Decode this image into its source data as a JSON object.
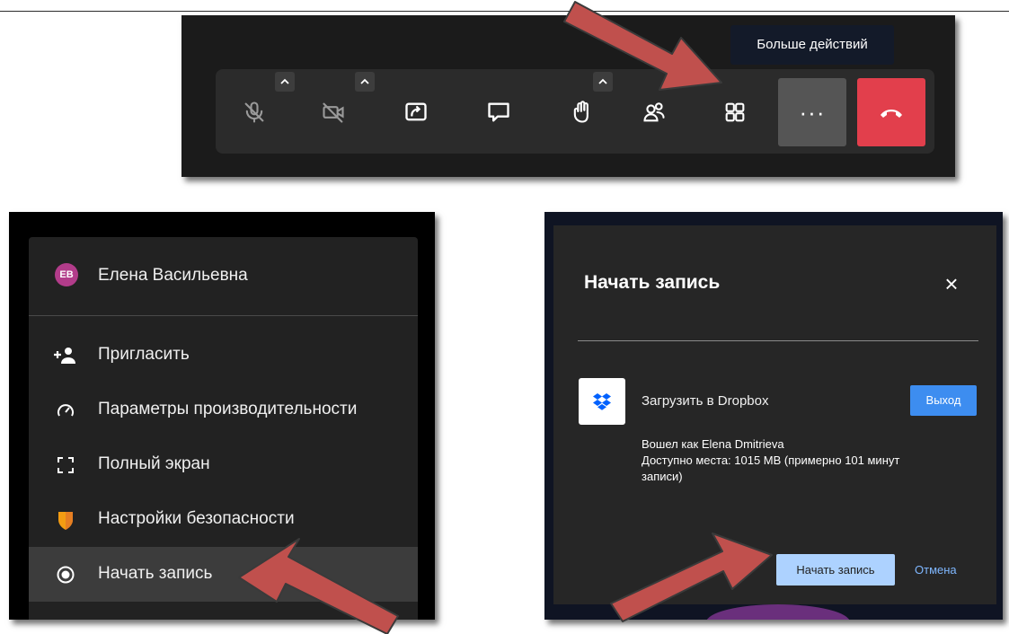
{
  "toolbar": {
    "tooltip": "Больше действий",
    "buttons": [
      {
        "name": "mic-muted-icon"
      },
      {
        "name": "camera-off-icon"
      },
      {
        "name": "screen-share-icon"
      },
      {
        "name": "chat-icon"
      },
      {
        "name": "raise-hand-icon"
      },
      {
        "name": "participants-icon"
      },
      {
        "name": "tile-view-icon"
      }
    ],
    "more_label": "···",
    "hangup_icon": "hang-up-icon",
    "colors": {
      "hangup": "#e23f4c",
      "more": "#555555",
      "bar": "#2b2b2b"
    }
  },
  "menu": {
    "user": {
      "initials": "EB",
      "name": "Елена Васильевна",
      "avatar_color": "#b23c8a"
    },
    "items": [
      {
        "label": "Пригласить",
        "icon": "add-person-icon"
      },
      {
        "label": "Параметры производительности",
        "icon": "gauge-icon"
      },
      {
        "label": "Полный экран",
        "icon": "fullscreen-icon"
      },
      {
        "label": "Настройки безопасности",
        "icon": "shield-icon"
      },
      {
        "label": "Начать запись",
        "icon": "record-icon",
        "active": true
      }
    ]
  },
  "dialog": {
    "title": "Начать запись",
    "close_label": "×",
    "provider_label": "Загрузить в Dropbox",
    "logout_label": "Выход",
    "info_lines": [
      "Вошел как Elena Dmitrieva",
      "Доступно места: 1015 MB (примерно 101 минут записи)"
    ],
    "start_label": "Начать запись",
    "cancel_label": "Отмена",
    "colors": {
      "logout": "#3d8df0",
      "start": "#add2ff",
      "cancel": "#7fb7ff"
    }
  },
  "annotations": {
    "arrow_color": "#c0504d"
  }
}
